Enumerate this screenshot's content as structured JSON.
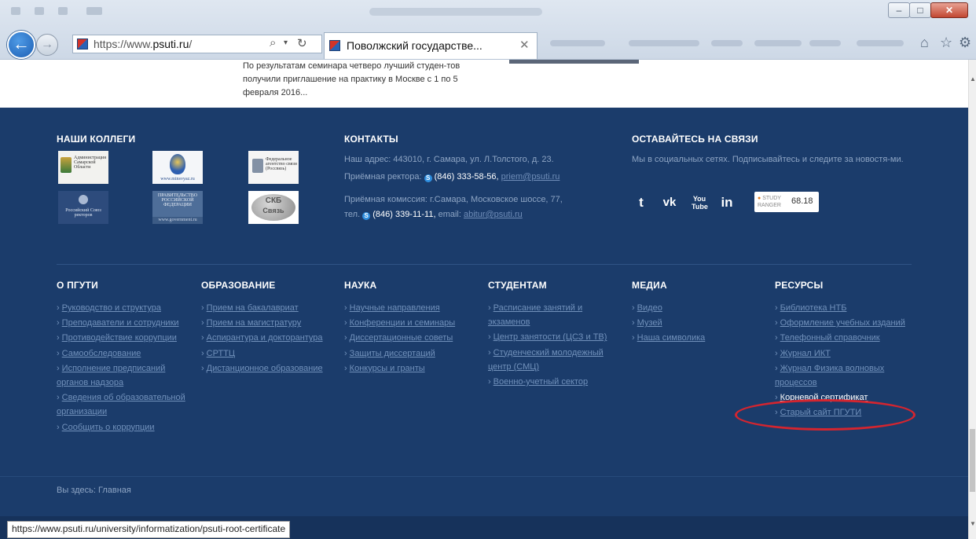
{
  "browser": {
    "address_url_prefix": "https://www.",
    "address_url_domain": "psuti.ru",
    "address_url_suffix": "/",
    "tab_title": "Поволжский государстве...",
    "tab_close": "✕",
    "status_url": "https://www.psuti.ru/university/informatization/psuti-root-certificate",
    "icons": [
      "back-icon",
      "forward-icon",
      "search-icon",
      "refresh-icon",
      "home-icon",
      "star-icon",
      "gear-icon"
    ]
  },
  "news": {
    "text": "По результатам семинара четверо лучший студен-тов получили приглашение на практику в Москве с 1 по 5 февраля 2016..."
  },
  "colleagues": {
    "heading": "НАШИ КОЛЛЕГИ",
    "logo_admin": "Администрация Самарской Области",
    "logo_emblem": "www.minsvyaz.ru",
    "logo_fed": "Федеральное агентство связи (Россвязь)",
    "logo_rector": "Российский Союз ректоров",
    "logo_gov": "ПРАВИТЕЛЬСТВО РОССИЙСКОЙ ФЕДЕРАЦИИ",
    "logo_gov_url": "www.government.ru",
    "logo_skb_1": "СКБ",
    "logo_skb_2": "Связь"
  },
  "contacts": {
    "heading": "КОНТАКТЫ",
    "address": "Наш адрес: 443010, г. Самара, ул. Л.Толстого, д. 23.",
    "rector_label": "Приёмная ректора:",
    "rector_phone": "(846) 333-58-56,",
    "rector_email": "priem@psuti.ru",
    "commission": "Приёмная комиссия: г.Самара, Московское шоссе, 77,",
    "commission_tel_label": "тел.",
    "commission_phone": "(846) 339-11-11,",
    "commission_email_label": "email:",
    "commission_email": "abitur@psuti.ru"
  },
  "social": {
    "heading": "ОСТАВАЙТЕСЬ НА СВЯЗИ",
    "text": "Мы в социальных сетях. Подписывайтесь и следите за новостя-ми.",
    "twitter": "t",
    "vk": "vk",
    "youtube": "You Tube",
    "linkedin": "in",
    "ranger_label_1": "STUDY",
    "ranger_label_2": "RANGER",
    "ranger_score": "68.18"
  },
  "footer": {
    "columns": [
      {
        "heading": "О ПГУТИ",
        "links": [
          "Руководство и структура",
          "Преподаватели и сотрудники",
          "Противодействие коррупции",
          "Самообследование",
          "Исполнение предписаний органов надзора",
          "Сведения об образовательной организации",
          "Сообщить о коррупции"
        ]
      },
      {
        "heading": "ОБРАЗОВАНИЕ",
        "links": [
          "Прием на бакалавриат",
          "Прием на магистратуру",
          "Аспирантура и докторантура",
          "СРТТЦ",
          "Дистанционное образование"
        ]
      },
      {
        "heading": "НАУКА",
        "links": [
          "Научные направления",
          "Конференции и семинары",
          "Диссертационные советы",
          "Защиты диссертаций",
          "Конкурсы и гранты"
        ]
      },
      {
        "heading": "СТУДЕНТАМ",
        "links": [
          "Расписание занятий и экзаменов",
          "Центр занятости (ЦСЗ и ТВ)",
          "Студенческий молодежный центр (СМЦ)",
          "Военно-учетный сектор"
        ]
      },
      {
        "heading": "МЕДИА",
        "links": [
          "Видео",
          "Музей",
          "Наша символика"
        ]
      },
      {
        "heading": "РЕСУРСЫ",
        "links": [
          "Библиотека НТБ",
          "Оформление учебных изданий",
          "Телефонный справочник",
          "Журнал ИКТ",
          "Журнал Физика волновых процессов",
          "Корневой сертификат",
          "Старый сайт ПГУТИ"
        ]
      }
    ],
    "chevron": "›"
  },
  "breadcrumb": "Вы здесь: Главная",
  "colors": {
    "footer_bg": "#1b3c6b",
    "link": "#7191bb",
    "highlight_ellipse": "#d4252f"
  }
}
